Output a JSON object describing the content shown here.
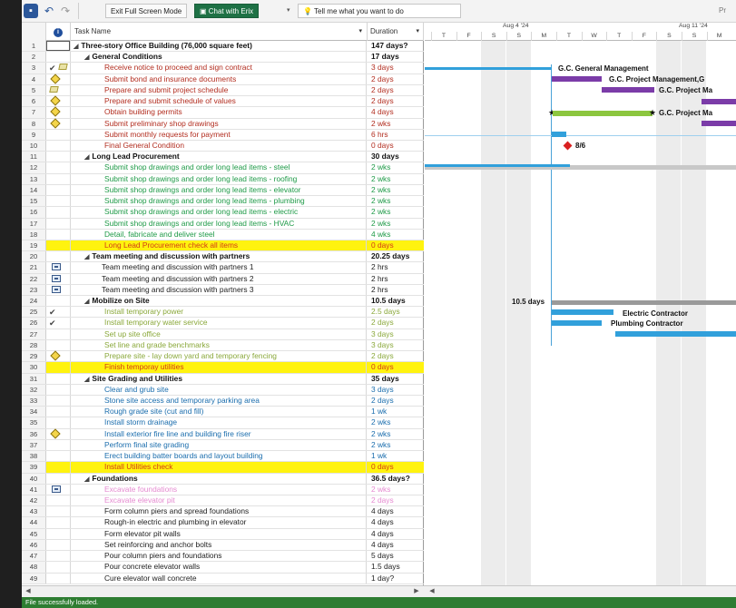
{
  "toolbar": {
    "exit_fullscreen": "Exit Full Screen Mode",
    "chat": "Chat with Erix",
    "tell_me": "Tell me what you want to do",
    "right_fragment": "Pr"
  },
  "grid_headers": {
    "name": "Task Name",
    "duration": "Duration"
  },
  "gantt_headers": {
    "week1": "Aug 4 '24",
    "week2": "Aug 11 '24",
    "days": [
      "T",
      "F",
      "S",
      "S",
      "M",
      "T",
      "W",
      "T",
      "F",
      "S",
      "S",
      "M"
    ]
  },
  "tasks": [
    {
      "id": "1",
      "name": "Three-story Office Building (76,000 square feet)",
      "dur": "147 days?",
      "style": "bold",
      "level": "lv0",
      "tri": "◢",
      "ind": "box"
    },
    {
      "id": "2",
      "name": "General Conditions",
      "dur": "17 days",
      "style": "bold",
      "level": "lv1",
      "tri": "◢",
      "ind": ""
    },
    {
      "id": "3",
      "name": "Receive notice to proceed and sign contract",
      "dur": "3 days",
      "style": "red",
      "level": "lv2",
      "ind": "check-note"
    },
    {
      "id": "4",
      "name": "Submit bond and insurance documents",
      "dur": "2 days",
      "style": "red",
      "level": "lv2",
      "ind": "diamond"
    },
    {
      "id": "5",
      "name": "Prepare and submit project schedule",
      "dur": "2 days",
      "style": "red",
      "level": "lv2",
      "ind": "note"
    },
    {
      "id": "6",
      "name": "Prepare and submit schedule of values",
      "dur": "2 days",
      "style": "red",
      "level": "lv2",
      "ind": "diamond"
    },
    {
      "id": "7",
      "name": "Obtain building permits",
      "dur": "4 days",
      "style": "red",
      "level": "lv2",
      "ind": "diamond"
    },
    {
      "id": "8",
      "name": "Submit preliminary shop drawings",
      "dur": "2 wks",
      "style": "red",
      "level": "lv2",
      "ind": "diamond"
    },
    {
      "id": "9",
      "name": "Submit monthly requests for payment",
      "dur": "6 hrs",
      "style": "red",
      "level": "lv2",
      "ind": ""
    },
    {
      "id": "10",
      "name": "Final General Condition",
      "dur": "0 days",
      "style": "red",
      "level": "lv2",
      "ind": ""
    },
    {
      "id": "11",
      "name": "Long Lead Procurement",
      "dur": "30 days",
      "style": "bold",
      "level": "lv1",
      "tri": "◢",
      "ind": ""
    },
    {
      "id": "12",
      "name": "Submit shop drawings and order long lead items - steel",
      "dur": "2 wks",
      "style": "green",
      "level": "lv2",
      "ind": ""
    },
    {
      "id": "13",
      "name": "Submit shop drawings and order long lead items - roofing",
      "dur": "2 wks",
      "style": "green",
      "level": "lv2",
      "ind": ""
    },
    {
      "id": "14",
      "name": "Submit shop drawings and order long lead items - elevator",
      "dur": "2 wks",
      "style": "green",
      "level": "lv2",
      "ind": ""
    },
    {
      "id": "15",
      "name": "Submit shop drawings and order long lead items - plumbing",
      "dur": "2 wks",
      "style": "green",
      "level": "lv2",
      "ind": ""
    },
    {
      "id": "16",
      "name": "Submit shop drawings and order long lead items - electric",
      "dur": "2 wks",
      "style": "green",
      "level": "lv2",
      "ind": ""
    },
    {
      "id": "17",
      "name": "Submit shop drawings and order long lead items - HVAC",
      "dur": "2 wks",
      "style": "green",
      "level": "lv2",
      "ind": ""
    },
    {
      "id": "18",
      "name": "Detail, fabricate and deliver steel",
      "dur": "4 wks",
      "style": "green",
      "level": "lv2",
      "ind": ""
    },
    {
      "id": "19",
      "name": "Long Lead Procurement check all items",
      "dur": "0 days",
      "style": "hlred",
      "level": "lv2",
      "ind": "",
      "hl": true
    },
    {
      "id": "20",
      "name": "Team meeting and discussion with partners",
      "dur": "20.25 days",
      "style": "bold",
      "level": "lv1",
      "tri": "◢",
      "ind": ""
    },
    {
      "id": "21",
      "name": "Team meeting and discussion with partners 1",
      "dur": "2 hrs",
      "style": "dark",
      "level": "lv2b",
      "ind": "cal"
    },
    {
      "id": "22",
      "name": "Team meeting and discussion with partners 2",
      "dur": "2 hrs",
      "style": "dark",
      "level": "lv2b",
      "ind": "cal"
    },
    {
      "id": "23",
      "name": "Team meeting and discussion with partners 3",
      "dur": "2 hrs",
      "style": "dark",
      "level": "lv2b",
      "ind": "cal"
    },
    {
      "id": "24",
      "name": "Mobilize on Site",
      "dur": "10.5 days",
      "style": "bold",
      "level": "lv1",
      "tri": "◢",
      "ind": ""
    },
    {
      "id": "25",
      "name": "Install temporary power",
      "dur": "2.5 days",
      "style": "olive",
      "level": "lv2",
      "ind": "check"
    },
    {
      "id": "26",
      "name": "Install temporary water service",
      "dur": "2 days",
      "style": "olive",
      "level": "lv2",
      "ind": "check"
    },
    {
      "id": "27",
      "name": "Set up site office",
      "dur": "3 days",
      "style": "olive",
      "level": "lv2",
      "ind": ""
    },
    {
      "id": "28",
      "name": "Set line and grade benchmarks",
      "dur": "3 days",
      "style": "olive",
      "level": "lv2",
      "ind": ""
    },
    {
      "id": "29",
      "name": "Prepare site - lay down yard and temporary fencing",
      "dur": "2 days",
      "style": "olive",
      "level": "lv2",
      "ind": "diamond"
    },
    {
      "id": "30",
      "name": "Finish temporay utilities",
      "dur": "0 days",
      "style": "hlred",
      "level": "lv2",
      "ind": "",
      "hl": true
    },
    {
      "id": "31",
      "name": "Site Grading and Utilities",
      "dur": "35 days",
      "style": "bold",
      "level": "lv1",
      "tri": "◢",
      "ind": ""
    },
    {
      "id": "32",
      "name": "Clear and grub site",
      "dur": "3 days",
      "style": "blue",
      "level": "lv2",
      "ind": ""
    },
    {
      "id": "33",
      "name": "Stone site access and temporary parking area",
      "dur": "2 days",
      "style": "blue",
      "level": "lv2",
      "ind": ""
    },
    {
      "id": "34",
      "name": "Rough grade site (cut and fill)",
      "dur": "1 wk",
      "style": "blue",
      "level": "lv2",
      "ind": ""
    },
    {
      "id": "35",
      "name": "Install storm drainage",
      "dur": "2 wks",
      "style": "blue",
      "level": "lv2",
      "ind": ""
    },
    {
      "id": "36",
      "name": "Install exterior fire line and building fire riser",
      "dur": "2 wks",
      "style": "blue",
      "level": "lv2",
      "ind": "diamond"
    },
    {
      "id": "37",
      "name": "Perform final site grading",
      "dur": "2 wks",
      "style": "blue",
      "level": "lv2",
      "ind": ""
    },
    {
      "id": "38",
      "name": "Erect building batter boards and layout building",
      "dur": "1 wk",
      "style": "blue",
      "level": "lv2",
      "ind": ""
    },
    {
      "id": "39",
      "name": "Install Utilities check",
      "dur": "0 days",
      "style": "hlred",
      "level": "lv2",
      "ind": "",
      "hl": true
    },
    {
      "id": "40",
      "name": "Foundations",
      "dur": "36.5 days?",
      "style": "bold",
      "level": "lv1",
      "tri": "◢",
      "ind": ""
    },
    {
      "id": "41",
      "name": "Excavate foundations",
      "dur": "2 wks",
      "style": "pink",
      "level": "lv2",
      "ind": "cal"
    },
    {
      "id": "42",
      "name": "Excavate elevator pit",
      "dur": "2 days",
      "style": "pink",
      "level": "lv2",
      "ind": ""
    },
    {
      "id": "43",
      "name": "Form column piers and spread foundations",
      "dur": "4 days",
      "style": "dark",
      "level": "lv2",
      "ind": ""
    },
    {
      "id": "44",
      "name": "Rough-in electric and plumbing in elevator",
      "dur": "4 days",
      "style": "dark",
      "level": "lv2",
      "ind": ""
    },
    {
      "id": "45",
      "name": "Form elevator pit walls",
      "dur": "4 days",
      "style": "dark",
      "level": "lv2",
      "ind": ""
    },
    {
      "id": "46",
      "name": "Set reinforcing and anchor bolts",
      "dur": "4 days",
      "style": "dark",
      "level": "lv2",
      "ind": ""
    },
    {
      "id": "47",
      "name": "Pour column piers and foundations",
      "dur": "5 days",
      "style": "dark",
      "level": "lv2",
      "ind": ""
    },
    {
      "id": "48",
      "name": "Pour concrete elevator walls",
      "dur": "1.5 days",
      "style": "dark",
      "level": "lv2",
      "ind": ""
    },
    {
      "id": "49",
      "name": "Cure elevator wall concrete",
      "dur": "1 day?",
      "style": "dark",
      "level": "lv2",
      "ind": ""
    }
  ],
  "gantt_labels": {
    "gc_management": "G.C. General Management",
    "gc_pm": "G.C. Project Management,G",
    "gc_pm2": "G.C. Project Ma",
    "gc_pm3": "G.C. Project Ma",
    "milestone": "8/6",
    "mobilize": "10.5 days",
    "electric": "Electric Contractor",
    "plumbing": "Plumbing Contractor"
  },
  "colors": {
    "status_bar": "#2e7d32",
    "gantt_purple": "#7b3ca8",
    "gantt_green": "#8cc63f",
    "gantt_blue": "#31a0db",
    "milestone": "#d92020",
    "highlight_row": "#fff30f"
  },
  "status": "File successfully loaded."
}
